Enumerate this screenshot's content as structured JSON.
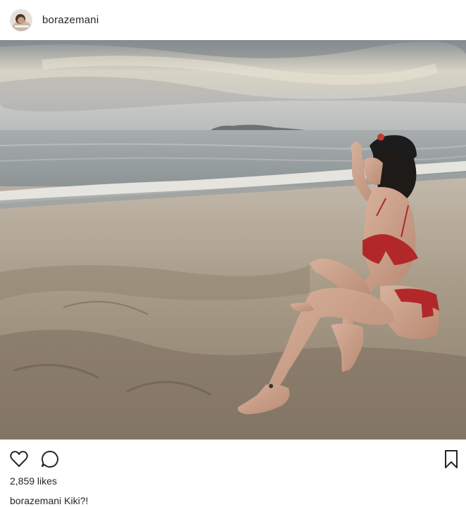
{
  "post": {
    "username": "borazemani",
    "likes_text": "2,859 likes",
    "caption_user": "borazemani",
    "caption_text": "Kiki?!"
  },
  "icons": {
    "like": "heart-outline-icon",
    "comment": "speech-bubble-icon",
    "save": "bookmark-outline-icon"
  },
  "colors": {
    "text": "#262626",
    "sky": "#c9c6bd",
    "sea": "#8e9ca0",
    "sand": "#a89a87",
    "swimsuit": "#b2282a"
  }
}
